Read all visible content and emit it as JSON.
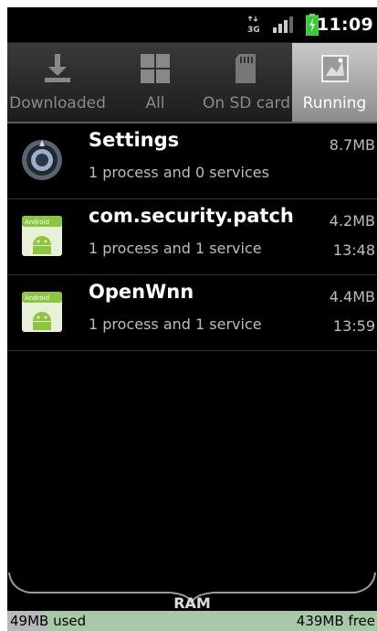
{
  "status_bar": {
    "time": "11:09",
    "icons": [
      "3g-data-icon",
      "signal-icon",
      "battery-charging-icon"
    ]
  },
  "tabs": [
    {
      "label": "Downloaded",
      "icon": "download-icon",
      "selected": false
    },
    {
      "label": "All",
      "icon": "grid-icon",
      "selected": false
    },
    {
      "label": "On SD card",
      "icon": "sd-card-icon",
      "selected": false
    },
    {
      "label": "Running",
      "icon": "running-apps-icon",
      "selected": true
    }
  ],
  "apps": [
    {
      "name": "Settings",
      "details": "1 process and 0 services",
      "size": "8.7MB",
      "time": "",
      "icon": "settings-icon"
    },
    {
      "name": "com.security.patch",
      "details": "1 process and 1 service",
      "size": "4.2MB",
      "time": "13:48",
      "icon": "android-app-icon"
    },
    {
      "name": "OpenWnn",
      "details": "1 process and 1 service",
      "size": "4.4MB",
      "time": "13:59",
      "icon": "android-app-icon"
    }
  ],
  "ram": {
    "label": "RAM",
    "used": "49MB used",
    "free": "439MB free",
    "used_fraction": 0.1
  },
  "colors": {
    "background": "#000000",
    "selected_tab": "#b0b0b0",
    "ram_free": "#a8c9a8"
  }
}
